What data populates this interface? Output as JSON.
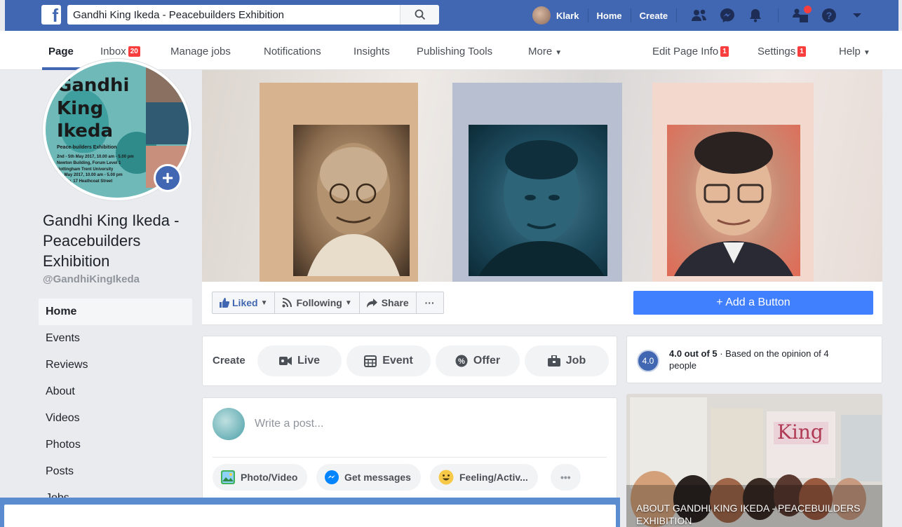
{
  "topbar": {
    "logo_letter": "f",
    "search_value": "Gandhi King Ikeda - Peacebuilders Exhibition",
    "user_name": "Klark",
    "home_label": "Home",
    "create_label": "Create",
    "icons": [
      "friends-icon",
      "messenger-icon",
      "notifications-icon",
      "page-icon",
      "help-icon",
      "dropdown-icon"
    ]
  },
  "page_nav": {
    "page_label": "Page",
    "inbox_label": "Inbox",
    "inbox_count": "20",
    "manage_jobs_label": "Manage jobs",
    "notifications_label": "Notifications",
    "insights_label": "Insights",
    "publishing_tools_label": "Publishing Tools",
    "more_label": "More",
    "edit_page_info_label": "Edit Page Info",
    "edit_page_info_count": "1",
    "settings_label": "Settings",
    "settings_count": "1",
    "help_label": "Help"
  },
  "profile": {
    "pic_text_line1": "Gandhi",
    "pic_text_line2": "King",
    "pic_text_line3": "Ikeda",
    "pic_subtitle": "Peace-builders Exhibition",
    "pic_dates1": "2nd - 5th May 2017, 10.00 am - 5.00 pm",
    "pic_venue1": "Newton Building, Forum Level 1",
    "pic_venue2": "Nottingham Trent University",
    "pic_dates2": "7th May 2017, 10.00 am - 5.00 pm",
    "pic_venue3": "Gallery, 17 Heathcoat Street",
    "page_name": "Gandhi King Ikeda - Peacebuilders Exhibition",
    "handle": "@GandhiKingIkeda"
  },
  "sidebar": {
    "items": [
      {
        "label": "Home",
        "active": true
      },
      {
        "label": "Events"
      },
      {
        "label": "Reviews"
      },
      {
        "label": "About"
      },
      {
        "label": "Videos"
      },
      {
        "label": "Photos"
      },
      {
        "label": "Posts"
      },
      {
        "label": "Jobs"
      }
    ]
  },
  "actions": {
    "liked_label": "Liked",
    "following_label": "Following",
    "share_label": "Share",
    "more_label": "···",
    "add_button_label": "+ Add a Button"
  },
  "create_card": {
    "label": "Create",
    "live_label": "Live",
    "event_label": "Event",
    "offer_label": "Offer",
    "job_label": "Job"
  },
  "rating": {
    "score": "4.0",
    "headline": "4.0 out of 5",
    "detail": " · Based on the opinion of 4 people"
  },
  "composer": {
    "placeholder": "Write a post...",
    "photo_video_label": "Photo/Video",
    "get_messages_label": "Get messages",
    "feeling_label": "Feeling/Activ...",
    "more_label": "•••"
  },
  "about": {
    "caption": "ABOUT GANDHI KING IKEDA - PEACEBUILDERS EXHIBITION",
    "sign_text": "King"
  },
  "colors": {
    "facebook_blue": "#4267b2",
    "add_button_blue": "#4080ff",
    "badge_red": "#fa3e3e"
  }
}
